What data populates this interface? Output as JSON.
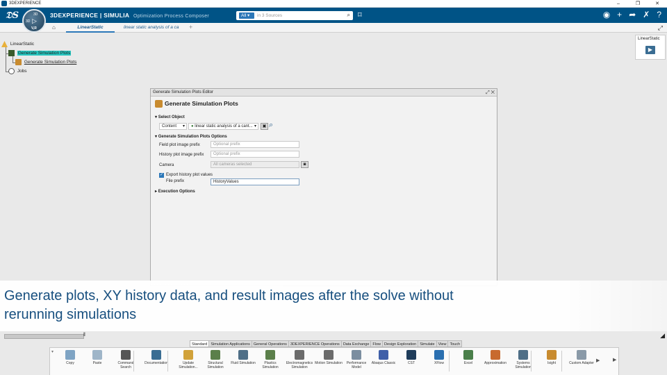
{
  "window": {
    "title": "3DEXPERIENCE",
    "controls": [
      "–",
      "❐",
      "✕"
    ]
  },
  "topbar": {
    "brand": "3DEXPERIENCE | SIMULIA",
    "app_name": "Optimization Process Composer",
    "search": {
      "scope": "All",
      "placeholder": "in 3 Sources"
    },
    "compass": {
      "version": "V,R"
    }
  },
  "tabs": {
    "active": "LinearStatic",
    "second": "linear static analysis of a ca",
    "add": "+"
  },
  "tree": {
    "root": "LinearStatic",
    "node1": "Generate Simulation Plots",
    "child1": "Generate Simulation Plots",
    "jobs": "Jobs"
  },
  "right_panel": {
    "label": "LinearStatic"
  },
  "editor": {
    "header": "Generate Simulation Plots Editor",
    "title": "Generate Simulation Plots",
    "select_object": {
      "section": "Select Object",
      "type_value": "Content",
      "object_value": "linear static analysis of a cant..."
    },
    "options": {
      "section": "Generate Simulation Plots Options",
      "field_prefix_label": "Field plot image prefix",
      "field_prefix_placeholder": "Optional prefix",
      "history_prefix_label": "History plot image prefix",
      "history_prefix_placeholder": "Optional prefix",
      "camera_label": "Camera",
      "camera_value": "All cameras selected",
      "export_label": "Export history plot values",
      "export_checked": true,
      "file_prefix_label": "File prefix",
      "file_prefix_value": "HistoryValues"
    },
    "execution": {
      "section": "Execution Options"
    }
  },
  "caption": {
    "text": "Generate plots, XY history data, and result images after the solve without rerunning simulations"
  },
  "section_tabs": [
    "Standard",
    "Simulation Applications",
    "General Operations",
    "3DEXPERIENCE Operations",
    "Data Exchange",
    "Flow",
    "Design Exploration",
    "Simulate",
    "View",
    "Touch"
  ],
  "section_tab_active": "Standard",
  "tools": [
    {
      "label": "Copy",
      "icon": "copy-icon",
      "color": "#7fa4c4"
    },
    {
      "label": "Paste",
      "icon": "paste-icon",
      "color": "#9fb5c8"
    },
    {
      "label": "Command Search",
      "icon": "command-search-icon",
      "color": "#555555"
    },
    {
      "label": "Documentation",
      "icon": "documentation-icon",
      "color": "#3a6d93"
    },
    {
      "label": "Update Simulation...",
      "icon": "update-simulation-icon",
      "color": "#d1a23a"
    },
    {
      "label": "Structural Simulation",
      "icon": "structural-simulation-icon",
      "color": "#5b7f4a"
    },
    {
      "label": "Fluid Simulation",
      "icon": "fluid-simulation-icon",
      "color": "#4f6f87"
    },
    {
      "label": "Plastics Simulation",
      "icon": "plastics-simulation-icon",
      "color": "#5b7f4a"
    },
    {
      "label": "Electromagnetics Simulation",
      "icon": "electromagnetics-simulation-icon",
      "color": "#6b6b6b"
    },
    {
      "label": "Motion Simulation",
      "icon": "motion-simulation-icon",
      "color": "#6b6b6b"
    },
    {
      "label": "Performance Model",
      "icon": "performance-model-icon",
      "color": "#7b8ea0"
    },
    {
      "label": "Abaqus Classic",
      "icon": "abaqus-classic-icon",
      "color": "#3f5fa8"
    },
    {
      "label": "CST",
      "icon": "cst-icon",
      "color": "#1f3c5a"
    },
    {
      "label": "XFlow",
      "icon": "xflow-icon",
      "color": "#2a6fb0"
    },
    {
      "label": "Excel",
      "icon": "excel-icon",
      "color": "#4a7f4a"
    },
    {
      "label": "Approximation",
      "icon": "approximation-icon",
      "color": "#c86a2f"
    },
    {
      "label": "Systems Simulation",
      "icon": "systems-simulation-icon",
      "color": "#4f6f87"
    },
    {
      "label": "Isight",
      "icon": "isight-icon",
      "color": "#c88b2f"
    },
    {
      "label": "Custom Adapter",
      "icon": "custom-adapter-icon",
      "color": "#8a9aa8"
    }
  ],
  "colors": {
    "brand_blue": "#005386",
    "accent": "#2b77b8",
    "highlight": "#27c7c0",
    "caption_text": "#174f7f"
  }
}
